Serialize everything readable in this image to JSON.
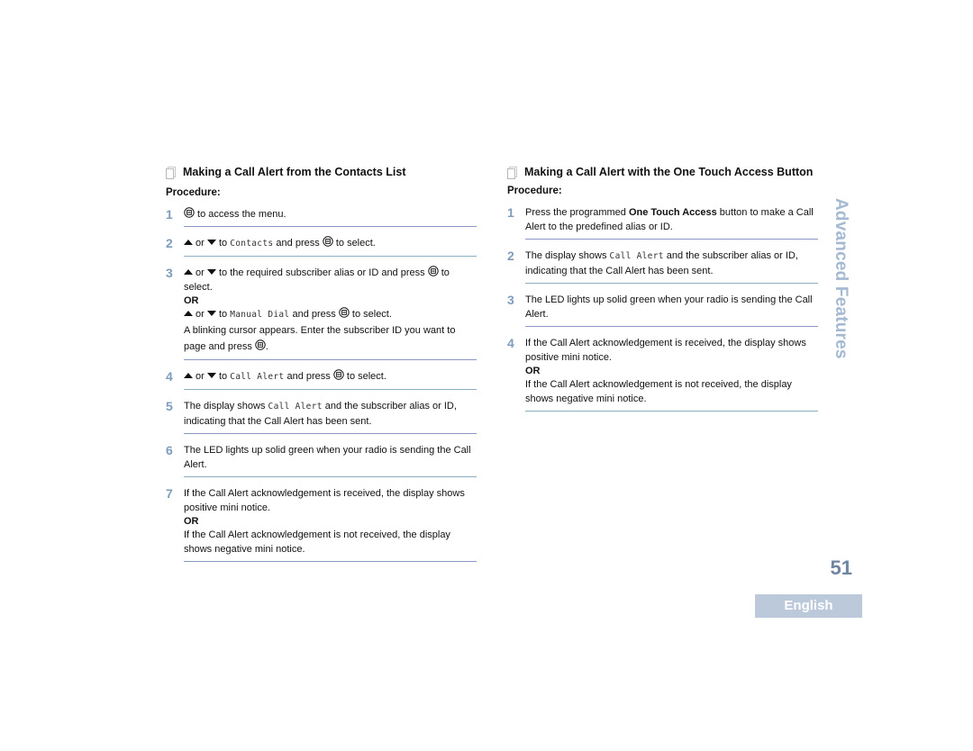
{
  "side_tab": "Advanced Features",
  "page_number": "51",
  "language_badge": "English",
  "colors": {
    "step_number": "#7f9cbd",
    "divider": "#8a96c6",
    "side_tab": "#a5b9d2",
    "page_number": "#6f86a3",
    "language_badge_bg": "#bcc9da"
  },
  "left": {
    "title": "Making a Call Alert from the Contacts List",
    "title_icon": "document-icon",
    "procedure_label": "Procedure:",
    "steps": [
      {
        "num": "1",
        "t1": " to access the menu."
      },
      {
        "num": "2",
        "or": " or ",
        "to": " to ",
        "mono": "Contacts",
        "press": " and press ",
        "end": " to select."
      },
      {
        "num": "3",
        "or": " or ",
        "t1": " to the required subscriber alias or ID and press ",
        "t2": " to select.",
        "or_label": "OR",
        "to": " to ",
        "mono": "Manual Dial",
        "press": " and press ",
        "end": " to select.",
        "t3": "A blinking cursor appears. Enter the subscriber ID you want to page and press ",
        "t4": "."
      },
      {
        "num": "4",
        "or": " or ",
        "to": " to ",
        "mono": "Call Alert",
        "press": " and press ",
        "end": " to select."
      },
      {
        "num": "5",
        "t1": "The display shows ",
        "mono": "Call Alert",
        "t2": " and the subscriber alias or ID, indicating that the Call Alert has been sent."
      },
      {
        "num": "6",
        "t1": "The LED lights up solid green when your radio is sending the Call Alert."
      },
      {
        "num": "7",
        "t1": "If the Call Alert acknowledgement is received, the display shows positive mini notice.",
        "or_label": "OR",
        "t2": "If the Call Alert acknowledgement is not received, the display shows negative mini notice."
      }
    ]
  },
  "right": {
    "title": "Making a Call Alert with the One Touch Access Button",
    "title_icon": "document-icon",
    "procedure_label": "Procedure:",
    "steps": [
      {
        "num": "1",
        "t1": "Press the programmed ",
        "bold": "One Touch Access",
        "t2": " button to make a Call Alert to the predefined alias or ID."
      },
      {
        "num": "2",
        "t1": "The display shows ",
        "mono": "Call Alert",
        "t2": " and the subscriber alias or ID, indicating that the Call Alert has been sent."
      },
      {
        "num": "3",
        "t1": "The LED lights up solid green when your radio is sending the Call Alert."
      },
      {
        "num": "4",
        "t1": "If the Call Alert acknowledgement is received, the display shows positive mini notice.",
        "or_label": "OR",
        "t2": "If the Call Alert acknowledgement is not received, the display shows negative mini notice."
      }
    ]
  }
}
